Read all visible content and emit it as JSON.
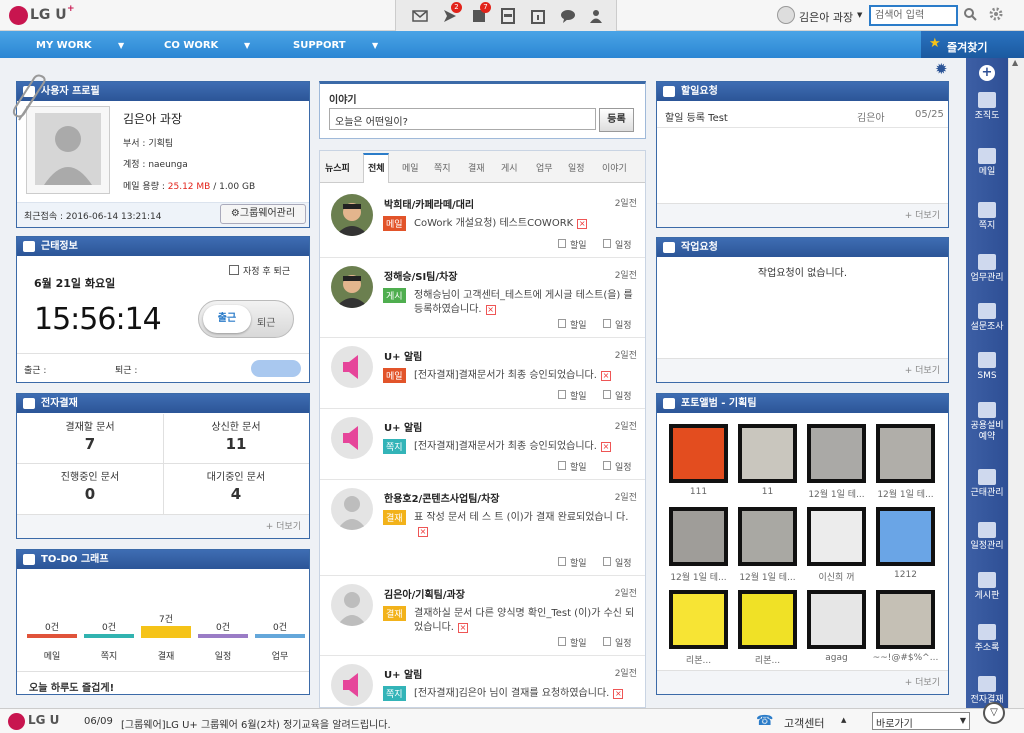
{
  "topbar": {
    "logo": "LG U",
    "badges": [
      "2",
      "7"
    ],
    "user": "김은아 과장",
    "search_placeholder": "검색어 입력"
  },
  "nav": {
    "items": [
      "MY WORK",
      "CO WORK",
      "SUPPORT"
    ],
    "favorites": "즐겨찾기"
  },
  "profile": {
    "title": "사용자 프로필",
    "name": "김은아 과장",
    "dept": "부서 :  기획팀",
    "account": "계정 :  naeunga",
    "mail_label": "메일 용량 :",
    "mail_used": "25.12 MB",
    "mail_total": "/ 1.00 GB",
    "last_login": "최근접속 : 2016-06-14 13:21:14",
    "groupware_btn": "그룹웨어관리"
  },
  "attendance": {
    "title": "근태정보",
    "date": "6월 21일 화요일",
    "time": "15:56:14",
    "auto_checkout": "자정 후 퇴근",
    "in_btn": "출근",
    "out_btn": "퇴근",
    "in_label": "출근 :",
    "out_label": "퇴근 :"
  },
  "approval": {
    "title": "전자결재",
    "items": [
      {
        "label": "결재할 문서",
        "value": "7"
      },
      {
        "label": "상신한 문서",
        "value": "11"
      },
      {
        "label": "진행중인 문서",
        "value": "0"
      },
      {
        "label": "대기중인 문서",
        "value": "4"
      }
    ],
    "more": "+ 더보기"
  },
  "todo": {
    "title": "TO-DO 그래프",
    "bars": [
      {
        "label": "메일",
        "count": "0건"
      },
      {
        "label": "쪽지",
        "count": "0건"
      },
      {
        "label": "결재",
        "count": "7건"
      },
      {
        "label": "일정",
        "count": "0건"
      },
      {
        "label": "업무",
        "count": "0건"
      }
    ],
    "footer": "오늘 하루도 즐겁게!",
    "colors": [
      "#e0533a",
      "#31b3b0",
      "#f5c318",
      "#9a7cc6",
      "#64a7da"
    ]
  },
  "story": {
    "title": "이야기",
    "placeholder": "오늘은 어떤일이?",
    "register": "등록"
  },
  "feed": {
    "tabs": [
      "뉴스피",
      "전체",
      "메일",
      "쪽지",
      "결재",
      "게시",
      "업무",
      "일정",
      "이야기"
    ],
    "action_done": "할일",
    "action_schedule": "일정",
    "items": [
      {
        "author": "박희태/카페라떼/대리",
        "time": "2일전",
        "tag": "메일",
        "tag_color": "#e2542a",
        "text": "CoWork 개설요청) 테스트COWORK"
      },
      {
        "author": "정해승/SI팀/차장",
        "time": "2일전",
        "tag": "게시",
        "tag_color": "#4fae4f",
        "text": "정해승님이 고객센터_테스트에 게시글 테스트(을) 를 등록하였습니다."
      },
      {
        "author": "U+ 알림",
        "time": "2일전",
        "tag": "메일",
        "tag_color": "#e2542a",
        "text": "[전자결재]결재문서가 최종 승인되었습니다."
      },
      {
        "author": "U+ 알림",
        "time": "2일전",
        "tag": "쪽지",
        "tag_color": "#33b4b8",
        "text": "[전자결재]결재문서가 최종 승인되었습니다."
      },
      {
        "author": "한용호2/콘텐츠사업팀/차장",
        "time": "2일전",
        "tag": "결재",
        "tag_color": "#f2b21a",
        "text": "표 작성 문서 테 스 트 (이)가 결재 완료되었습니 다."
      },
      {
        "author": "김은아/기획팀/과장",
        "time": "2일전",
        "tag": "결재",
        "tag_color": "#f2b21a",
        "text": "결재하실 문서 다른 양식명 확인_Test (이)가 수신 되었습니다."
      },
      {
        "author": "U+ 알림",
        "time": "2일전",
        "tag": "쪽지",
        "tag_color": "#33b4b8",
        "text": "[전자결재]김은아 님이 결재를 요청하였습니다."
      }
    ]
  },
  "tasks": {
    "title": "할일요청",
    "row": "할일 등록 Test",
    "owner": "김은아",
    "date": "05/25",
    "more": "+ 더보기"
  },
  "work": {
    "title": "작업요청",
    "empty": "작업요청이 없습니다.",
    "more": "+ 더보기"
  },
  "album": {
    "title": "포토앨범 - 기획팀",
    "captions": [
      "111",
      "11",
      "12월 1일 테...",
      "12월 1일 테...",
      "12월 1일 테...",
      "12월 1일 테...",
      "이신희 꺼",
      "1212",
      "리본...",
      "리본...",
      "agag",
      "~~!@#$%^..."
    ],
    "more": "+ 더보기"
  },
  "sidebar": {
    "items": [
      "조직도",
      "메일",
      "쪽지",
      "업무관리",
      "설문조사",
      "SMS",
      "공용설비 예약",
      "근태관리",
      "일정관리",
      "게시판",
      "주소록",
      "전자결재"
    ]
  },
  "bottom": {
    "date": "06/09",
    "notice": "[그룹웨어]LG U+ 그룹웨어 6월(2차) 정기교육을 알려드립니다.",
    "support": "고객센터",
    "goto": "바로가기"
  }
}
